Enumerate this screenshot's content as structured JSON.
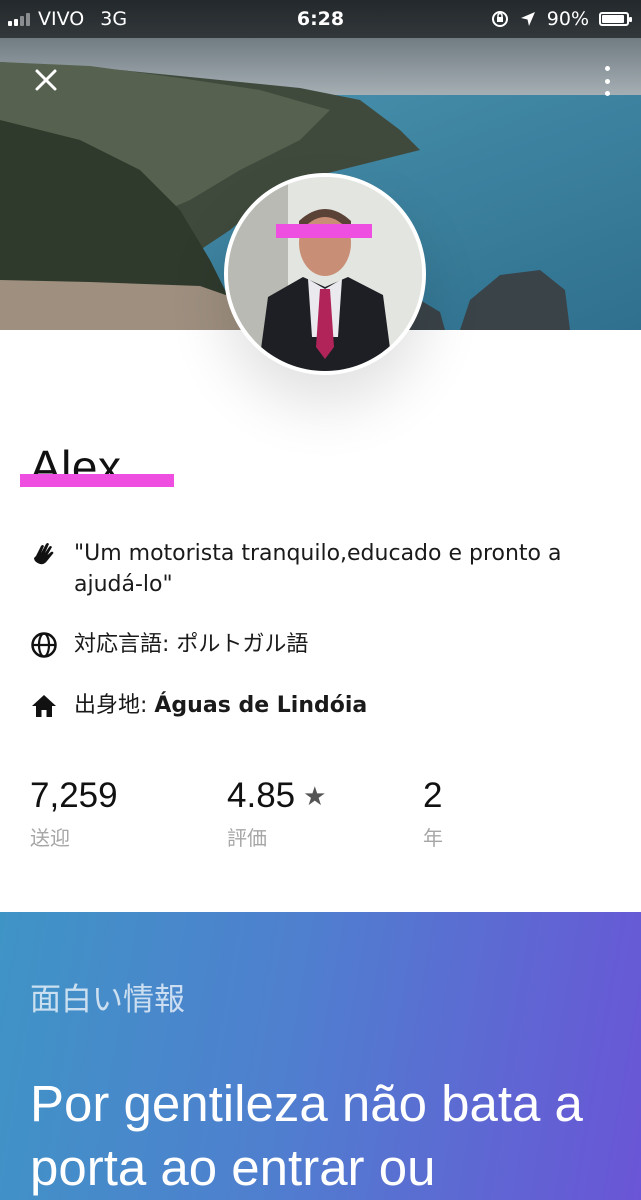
{
  "status_bar": {
    "carrier": "VIVO",
    "network": "3G",
    "time": "6:28",
    "battery": "90%",
    "battery_level": 0.9
  },
  "header": {
    "close_icon": "close-icon",
    "more_icon": "more-vertical-icon"
  },
  "profile": {
    "name": "Alex",
    "quote": "\"Um motorista tranquilo,educado e pronto a ajudá-lo\"",
    "languages_label": "対応言語: ",
    "languages_value": "ポルトガル語",
    "hometown_label": "出身地: ",
    "hometown_value": "Águas de Lindóia"
  },
  "stats": {
    "trips_value": "7,259",
    "trips_label": "送迎",
    "rating_value": "4.85",
    "rating_label": "評価",
    "years_value": "2",
    "years_label": "年"
  },
  "fun_fact": {
    "title": "面白い情報",
    "text": "Por gentileza não bata a porta ao entrar ou"
  },
  "colors": {
    "redaction": "#ee4fe0",
    "card_gradient_start": "#3f94c6",
    "card_gradient_end": "#6a55d6"
  }
}
